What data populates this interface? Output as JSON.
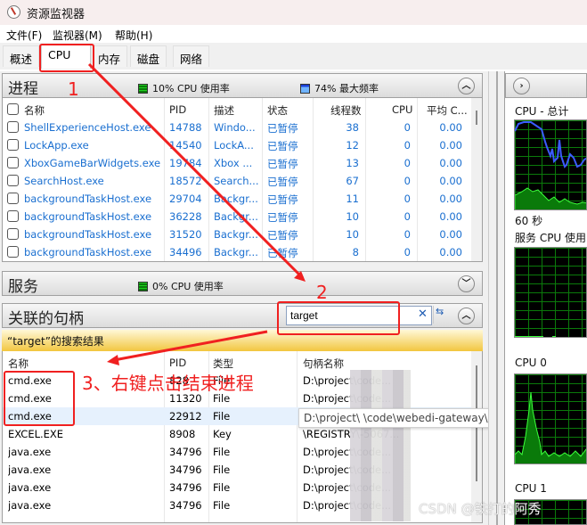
{
  "window": {
    "title": "资源监视器",
    "icon": "resource-monitor-icon"
  },
  "menu": [
    "文件(F)",
    "监视器(M)",
    "帮助(H)"
  ],
  "tabs": [
    {
      "label": "概述",
      "active": false
    },
    {
      "label": "CPU",
      "active": true
    },
    {
      "label": "内存",
      "active": false
    },
    {
      "label": "磁盘",
      "active": false
    },
    {
      "label": "网络",
      "active": false
    }
  ],
  "processes": {
    "title": "进程",
    "cpu_usage": "10% CPU 使用率",
    "max_freq": "74% 最大频率",
    "collapse_icon": "chevron-up-icon",
    "columns": [
      "名称",
      "PID",
      "描述",
      "状态",
      "线程数",
      "CPU",
      "平均 C..."
    ],
    "rows": [
      {
        "name": "ShellExperienceHost.exe",
        "pid": "14788",
        "desc": "Windo...",
        "status": "已暂停",
        "threads": "38",
        "cpu": "0",
        "avg": "0.00"
      },
      {
        "name": "LockApp.exe",
        "pid": "14540",
        "desc": "LockA...",
        "status": "已暂停",
        "threads": "12",
        "cpu": "0",
        "avg": "0.00"
      },
      {
        "name": "XboxGameBarWidgets.exe",
        "pid": "19784",
        "desc": "Xbox ...",
        "status": "已暂停",
        "threads": "13",
        "cpu": "0",
        "avg": "0.00"
      },
      {
        "name": "SearchHost.exe",
        "pid": "18572",
        "desc": "Search...",
        "status": "已暂停",
        "threads": "67",
        "cpu": "0",
        "avg": "0.00"
      },
      {
        "name": "backgroundTaskHost.exe",
        "pid": "29704",
        "desc": "Backgr...",
        "status": "已暂停",
        "threads": "11",
        "cpu": "0",
        "avg": "0.00"
      },
      {
        "name": "backgroundTaskHost.exe",
        "pid": "36228",
        "desc": "Backgr...",
        "status": "已暂停",
        "threads": "10",
        "cpu": "0",
        "avg": "0.00"
      },
      {
        "name": "backgroundTaskHost.exe",
        "pid": "31520",
        "desc": "Backgr...",
        "status": "已暂停",
        "threads": "10",
        "cpu": "0",
        "avg": "0.00"
      },
      {
        "name": "backgroundTaskHost.exe",
        "pid": "34496",
        "desc": "Backgr...",
        "status": "已暂停",
        "threads": "8",
        "cpu": "0",
        "avg": "0.00"
      }
    ]
  },
  "services": {
    "title": "服务",
    "cpu_usage": "0% CPU 使用率",
    "expand_icon": "chevron-down-icon"
  },
  "handles": {
    "title": "关联的句柄",
    "search_value": "target",
    "result_label": "“target”的搜索结果",
    "columns": [
      "名称",
      "PID",
      "类型",
      "句柄名称"
    ],
    "rows": [
      {
        "name": "cmd.exe",
        "pid": "828",
        "type": "File",
        "handle": "D:\\project\\code..."
      },
      {
        "name": "cmd.exe",
        "pid": "11320",
        "type": "File",
        "handle": "D:\\project\\code..."
      },
      {
        "name": "cmd.exe",
        "pid": "22912",
        "type": "File",
        "handle": "D:\\project\\",
        "selected": true
      },
      {
        "name": "EXCEL.EXE",
        "pid": "8908",
        "type": "Key",
        "handle": "\\REGISTRY\\-5067..."
      },
      {
        "name": "java.exe",
        "pid": "34796",
        "type": "File",
        "handle": "D:\\project\\code..."
      },
      {
        "name": "java.exe",
        "pid": "34796",
        "type": "File",
        "handle": "D:\\project\\code..."
      },
      {
        "name": "java.exe",
        "pid": "34796",
        "type": "File",
        "handle": "D:\\project\\code..."
      },
      {
        "name": "java.exe",
        "pid": "34796",
        "type": "File",
        "handle": "D:\\project\\code..."
      }
    ],
    "tooltip": "D:\\project\\            \\code\\webedi-gateway\\target"
  },
  "graphs": {
    "expand_icon": "chevron-right-icon",
    "cpu_total_label": "CPU - 总计",
    "time_label": "60 秒",
    "service_cpu_label": "服务 CPU 使用",
    "cpu0_label": "CPU 0",
    "cpu1_label": "CPU 1"
  },
  "annotations": {
    "step1": "1",
    "step2": "2",
    "step3": "3、右键点击结束进程"
  },
  "watermark": "CSDN @铁打的阿秀"
}
